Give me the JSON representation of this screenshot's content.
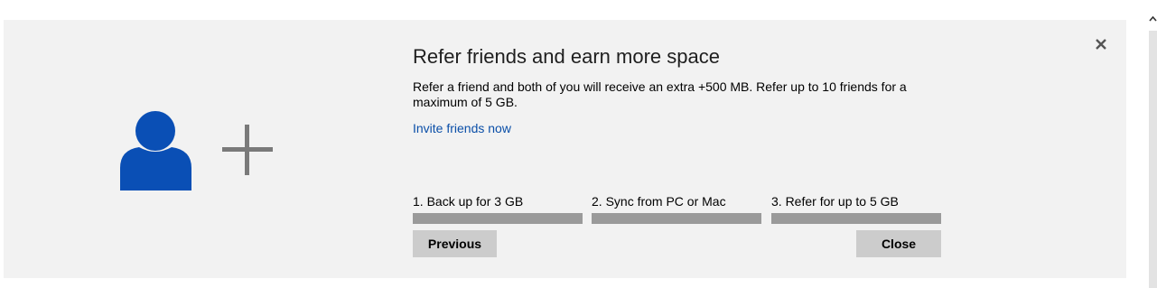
{
  "banner": {
    "title": "Refer friends and earn more space",
    "description": "Refer a friend and both of you will receive an extra +500 MB. Refer up to 10 friends for a maximum of 5 GB.",
    "invite_link": "Invite friends now",
    "illustration_icons": [
      "person-icon",
      "plus-icon"
    ],
    "dismiss_icon": "close-icon"
  },
  "steps": [
    {
      "label": "1. Back up for 3 GB"
    },
    {
      "label": "2. Sync from PC or Mac"
    },
    {
      "label": "3. Refer for up to 5 GB"
    }
  ],
  "buttons": {
    "previous": "Previous",
    "close": "Close"
  },
  "colors": {
    "accent": "#0b4fa8",
    "person_icon": "#0a4fb5",
    "panel_bg": "#f2f2f2",
    "step_bar": "#9a9a9a",
    "button_bg": "#cccccc"
  }
}
